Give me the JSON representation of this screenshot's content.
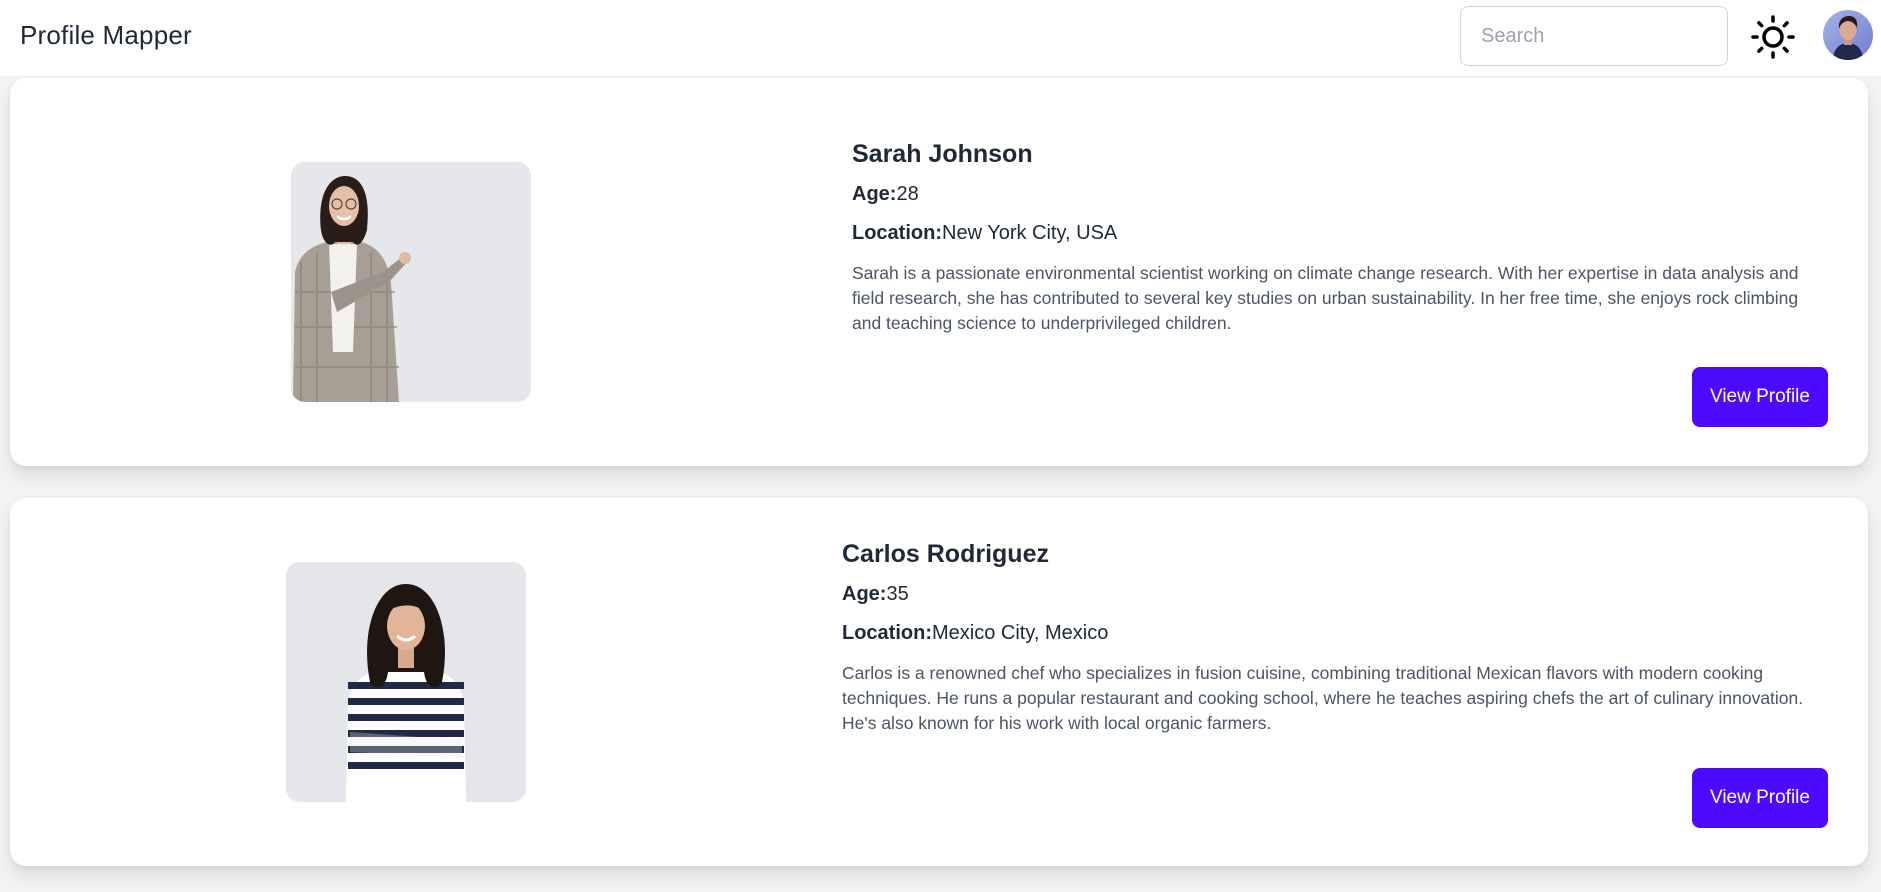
{
  "app": {
    "title": "Profile Mapper"
  },
  "header": {
    "search_placeholder": "Search",
    "theme_icon": "sun-icon",
    "avatar_icon": "user-avatar"
  },
  "colors": {
    "accent": "#4c0aff",
    "background": "#f3f4f6",
    "card": "#ffffff"
  },
  "profiles": [
    {
      "name": "Sarah Johnson",
      "age_label": "Age:",
      "age": "28",
      "location_label": "Location:",
      "location": "New York City, USA",
      "bio": "Sarah is a passionate environmental scientist working on climate change research. With her expertise in data analysis and field research, she has contributed to several key studies on urban sustainability. In her free time, she enjoys rock climbing and teaching science to underprivileged children.",
      "button_label": "View Profile"
    },
    {
      "name": "Carlos Rodriguez",
      "age_label": "Age:",
      "age": "35",
      "location_label": "Location:",
      "location": "Mexico City, Mexico",
      "bio": "Carlos is a renowned chef who specializes in fusion cuisine, combining traditional Mexican flavors with modern cooking techniques. He runs a popular restaurant and cooking school, where he teaches aspiring chefs the art of culinary innovation. He's also known for his work with local organic farmers.",
      "button_label": "View Profile"
    }
  ]
}
